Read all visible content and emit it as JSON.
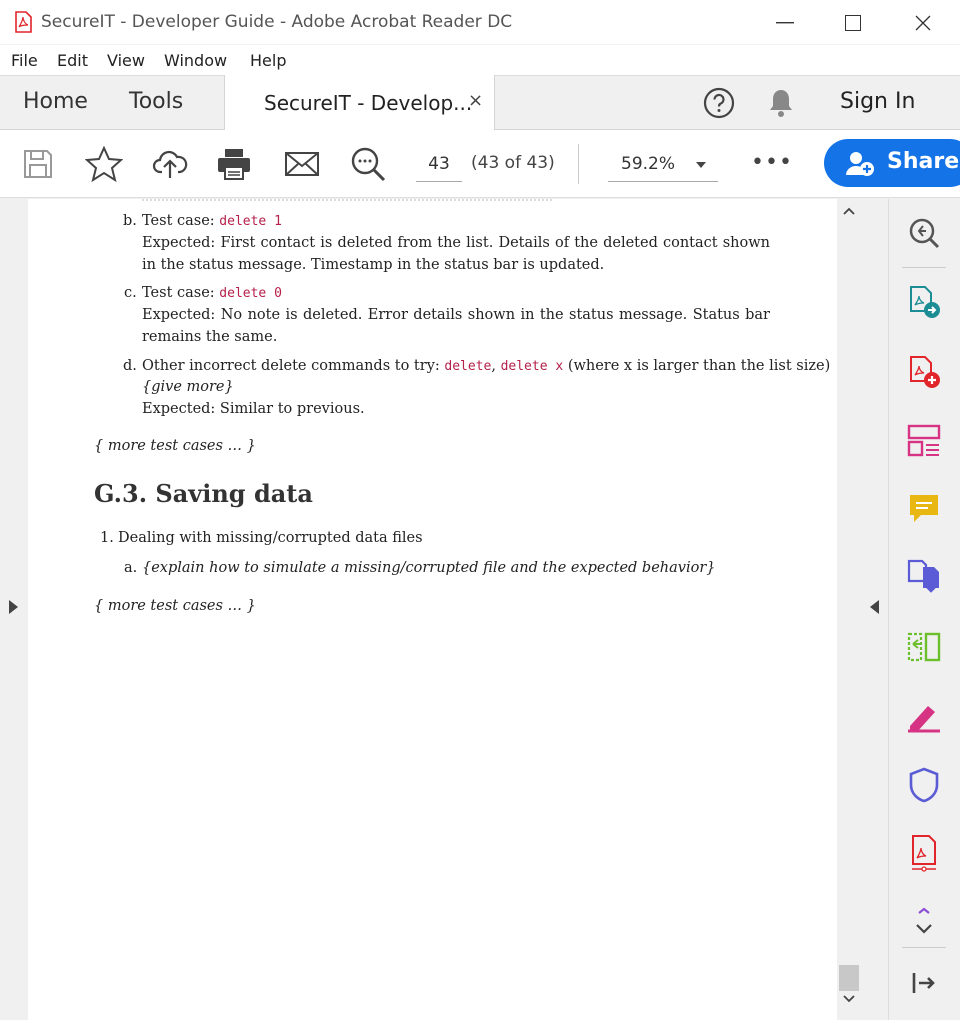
{
  "window": {
    "title": "SecureIT - Developer Guide - Adobe Acrobat Reader DC"
  },
  "menu": [
    "File",
    "Edit",
    "View",
    "Window",
    "Help"
  ],
  "tabs": {
    "home": "Home",
    "tools": "Tools",
    "document": "SecureIT - Develop...",
    "close": "×",
    "signin": "Sign In"
  },
  "toolbar": {
    "page_number": "43",
    "page_count": "(43 of 43)",
    "zoom": "59.2%",
    "more": "•••",
    "share": "Share"
  },
  "document": {
    "item_b": {
      "letter": "b.",
      "prefix": "Test case:",
      "code": "delete 1",
      "expected": "Expected: First contact is deleted from the list. Details of the deleted contact shown in the status message. Timestamp in the status bar is updated."
    },
    "item_c": {
      "letter": "c.",
      "prefix": "Test case:",
      "code": "delete 0",
      "expected": "Expected: No note is deleted. Error details shown in the status message. Status bar remains the same."
    },
    "item_d": {
      "letter": "d.",
      "prefix": "Other incorrect delete commands to try:",
      "code1": "delete",
      "comma": ",",
      "code2": "delete x",
      "suffix": "(where x is larger than the list size)",
      "give_more": "{give more}",
      "expected": "Expected: Similar to previous."
    },
    "more_cases_1": "{ more test cases … }",
    "heading": "G.3. Saving data",
    "list_1": {
      "number": "1.",
      "text": "Dealing with missing/corrupted data files"
    },
    "list_1a": {
      "letter": "a.",
      "text": "{explain how to simulate a missing/corrupted file and the expected behavior}"
    },
    "more_cases_2": "{ more test cases … }"
  },
  "colors": {
    "accent": "#1473e6",
    "code": "#b5214a",
    "acrobat_red": "#e0252b"
  },
  "right_tools": [
    "zoom-tool-icon",
    "export-pdf-icon",
    "create-pdf-icon",
    "organize-pages-icon",
    "comment-icon",
    "combine-files-icon",
    "compress-pdf-icon",
    "fill-sign-icon",
    "protect-icon",
    "more-tools-pdf-icon",
    "expand-collapse-icon",
    "exit-panel-icon"
  ]
}
